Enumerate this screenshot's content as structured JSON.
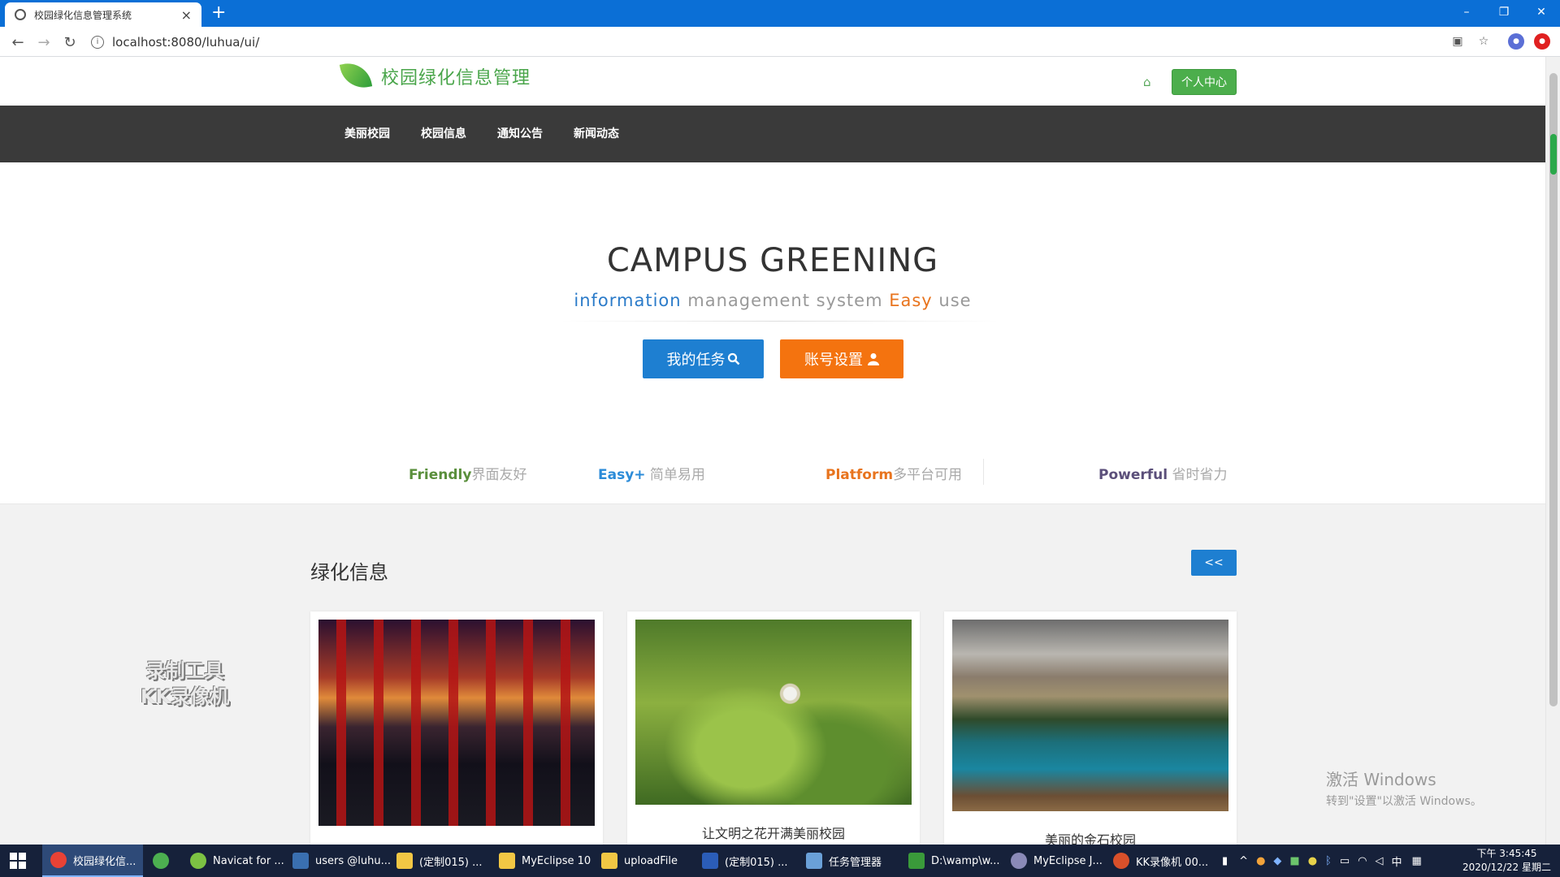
{
  "browser": {
    "tab_title": "校园绿化信息管理系统",
    "tab_close": "×",
    "new_tab": "+",
    "url": "localhost:8080/luhua/ui/",
    "window_controls": [
      "–",
      "❐",
      "✕"
    ]
  },
  "header": {
    "brand_title": "校园绿化信息管理",
    "user_center_label": "个人中心"
  },
  "nav": {
    "items": [
      "美丽校园",
      "校园信息",
      "通知公告",
      "新闻动态"
    ]
  },
  "hero": {
    "title": "CAMPUS GREENING",
    "sub_information": "information",
    "sub_management": " management system ",
    "sub_easy": "Easy",
    "sub_use": " use",
    "task_button": "我的任务",
    "account_button": "账号设置"
  },
  "features": [
    {
      "strong": "Friendly",
      "text": "界面友好",
      "color": "#5a8f3c"
    },
    {
      "strong": "Easy+",
      "text": " 简单易用",
      "color": "#2b8bd8"
    },
    {
      "strong": "Platform",
      "text": "多平台可用",
      "color": "#e8741e"
    },
    {
      "strong": "Powerful",
      "text": " 省时省力",
      "color": "#5b4f7a"
    }
  ],
  "section": {
    "title": "绿化信息",
    "button": "<<"
  },
  "cards": [
    {
      "caption": ""
    },
    {
      "caption": "让文明之花开满美丽校园"
    },
    {
      "caption": "美丽的金石校园"
    }
  ],
  "overlay": {
    "line1": "录制工具",
    "line2": "KK录像机"
  },
  "activation": {
    "line1": "激活 Windows",
    "line2": "转到\"设置\"以激活 Windows。"
  },
  "taskbar": {
    "items": [
      {
        "label": "校园绿化信...",
        "color": "#e94235",
        "active": true
      },
      {
        "label": "",
        "color": "#4caf50",
        "active": false
      },
      {
        "label": "Navicat for ...",
        "color": "#7cc243",
        "active": false
      },
      {
        "label": "users @luhu...",
        "color": "#3a6fb0",
        "active": false
      },
      {
        "label": "(定制015) ...",
        "color": "#f2c744",
        "active": false
      },
      {
        "label": "MyEclipse 10",
        "color": "#f2c744",
        "active": false
      },
      {
        "label": "uploadFile",
        "color": "#f2c744",
        "active": false
      },
      {
        "label": "(定制015) ...",
        "color": "#2b5db8",
        "active": false
      },
      {
        "label": "任务管理器",
        "color": "#6aa0d8",
        "active": false
      },
      {
        "label": "D:\\wamp\\w...",
        "color": "#3a9a3a",
        "active": false
      },
      {
        "label": "MyEclipse J...",
        "color": "#8a8ab8",
        "active": false
      },
      {
        "label": "KK录像机 00...",
        "color": "#d8502a",
        "active": false
      }
    ],
    "tray_lang": "中",
    "time": "下午 3:45:45",
    "date": "2020/12/22 星期二"
  },
  "colors": {
    "tab_bar": "#0b6fd6",
    "brand_green": "#49a54a",
    "nav_bg": "#3a3a3a",
    "primary_blue": "#1e7fd1",
    "accent_orange": "#f4730f"
  }
}
